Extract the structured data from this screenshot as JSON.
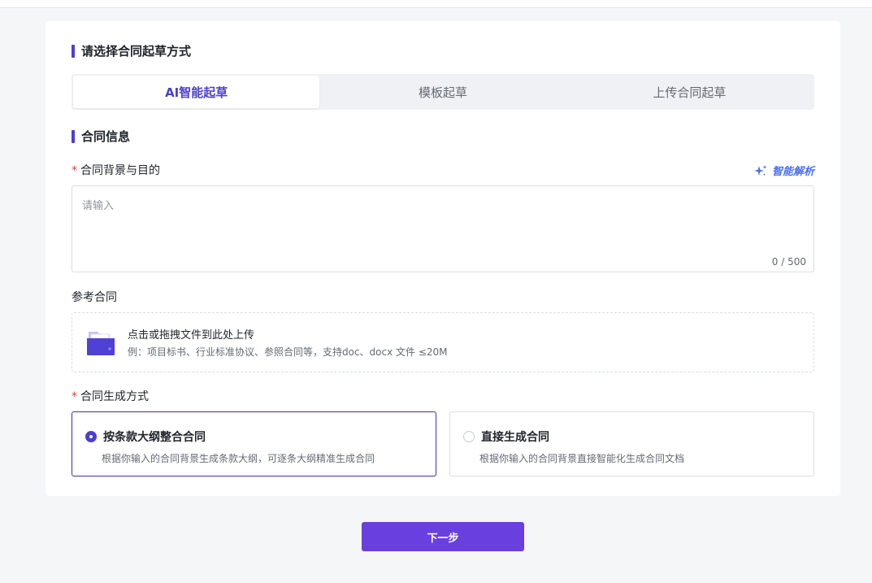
{
  "sections": {
    "draft_method_title": "请选择合同起草方式",
    "contract_info_title": "合同信息"
  },
  "tabs": [
    {
      "label": "AI智能起草",
      "active": true
    },
    {
      "label": "模板起草",
      "active": false
    },
    {
      "label": "上传合同起草",
      "active": false
    }
  ],
  "background_field": {
    "required_mark": "*",
    "label": "合同背景与目的",
    "smart_parse": "智能解析",
    "placeholder": "请输入",
    "value": "",
    "counter": "0 / 500"
  },
  "reference": {
    "label": "参考合同",
    "upload_title": "点击或拖拽文件到此处上传",
    "upload_hint": "例：项目标书、行业标准协议、参照合同等，支持doc、docx 文件 ≤20M",
    "icon": "folder-upload-icon"
  },
  "generation": {
    "required_mark": "*",
    "label": "合同生成方式",
    "options": [
      {
        "title": "按条款大纲整合合同",
        "desc": "根据你输入的合同背景生成条款大纲，可逐条大纲精准生成合同",
        "selected": true
      },
      {
        "title": "直接生成合同",
        "desc": "根据你输入的合同背景直接智能化生成合同文档",
        "selected": false
      }
    ]
  },
  "next_button": "下一步",
  "colors": {
    "accent": "#4b3fd1",
    "button": "#6a3fe0",
    "smart_parse": "#4b6ff0",
    "required": "#e53e3e"
  }
}
